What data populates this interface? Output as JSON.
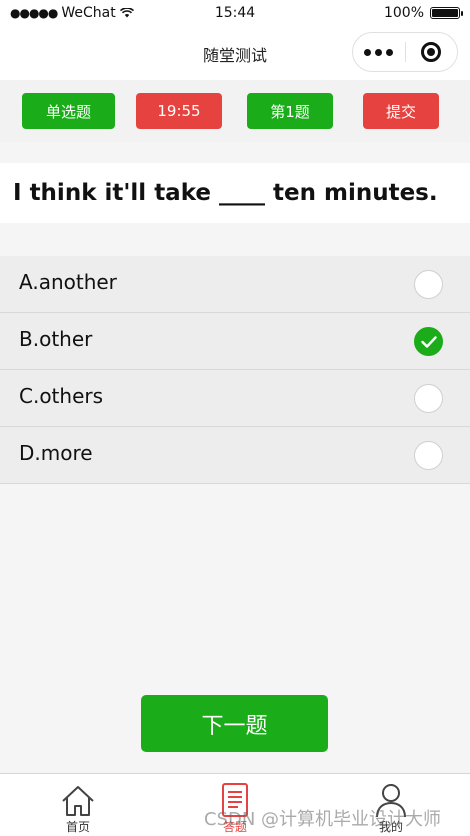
{
  "status_bar": {
    "signal_dots": "●●●●●",
    "carrier": "WeChat",
    "time": "15:44",
    "battery": "100%"
  },
  "navbar": {
    "title": "随堂测试"
  },
  "toolbar": {
    "type_label": "单选题",
    "timer": "19:55",
    "question_number": "第1题",
    "submit_label": "提交"
  },
  "question": {
    "text": "I think it'll take ____ ten minutes."
  },
  "options": [
    {
      "label": "A.another",
      "selected": false
    },
    {
      "label": "B.other",
      "selected": true
    },
    {
      "label": "C.others",
      "selected": false
    },
    {
      "label": "D.more",
      "selected": false
    }
  ],
  "next_button": {
    "label": "下一题"
  },
  "tabbar": {
    "items": [
      {
        "label": "首页",
        "icon": "home-icon",
        "active": false
      },
      {
        "label": "答题",
        "icon": "document-icon",
        "active": true
      },
      {
        "label": "我的",
        "icon": "user-icon",
        "active": false
      }
    ]
  },
  "watermark": {
    "text": "CSDN @计算机毕业设计大师"
  },
  "colors": {
    "accent_green": "#1aad19",
    "accent_red": "#e64340"
  }
}
